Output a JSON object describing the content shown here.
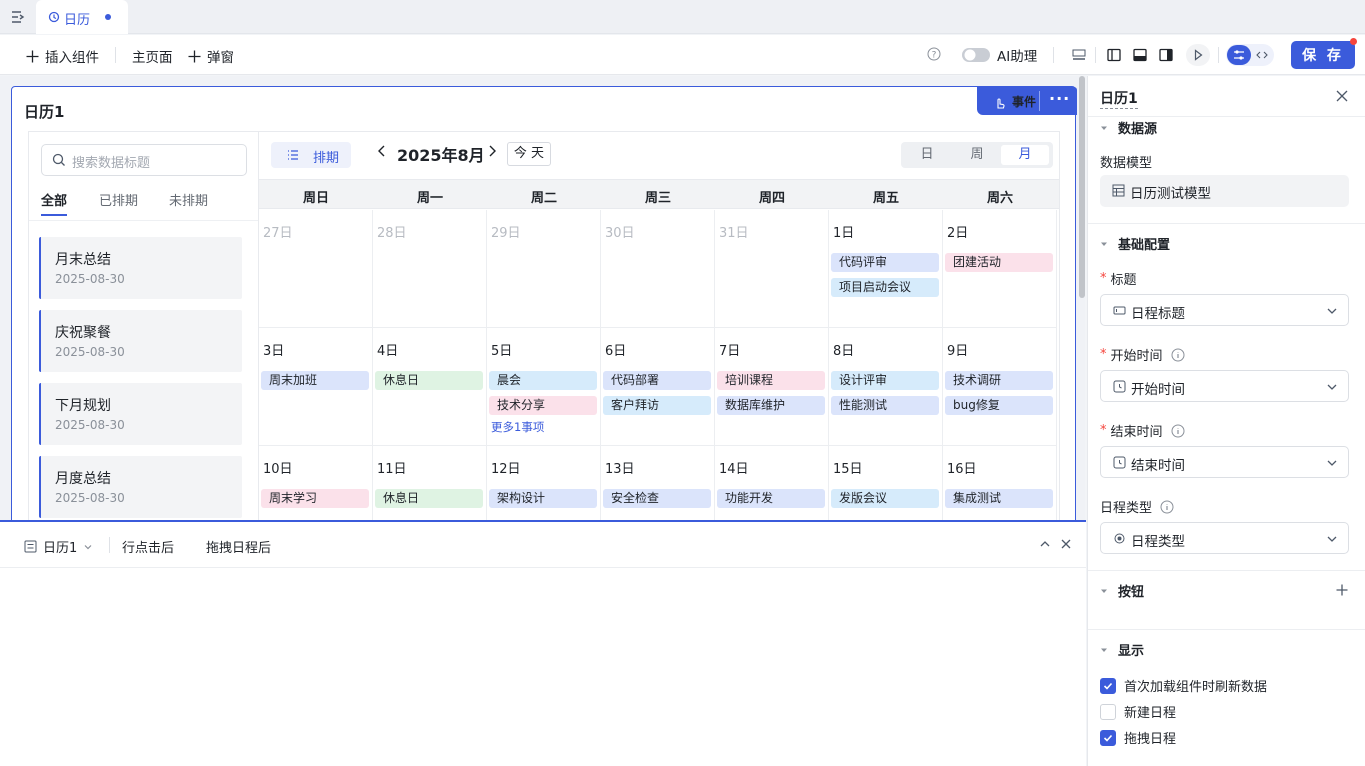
{
  "colors": {
    "accent": "#3b5bdb",
    "event_blue": "#dbe4fb",
    "event_pink": "#fbe1ea",
    "event_green": "#dff3e3",
    "event_sky": "#d6ebfb"
  },
  "tab": {
    "label": "日历",
    "icon": "calendar-icon"
  },
  "toolbar": {
    "insert_label": "插入组件",
    "home_label": "主页面",
    "popup_label": "弹窗",
    "ai_label": "AI助理",
    "ai_enabled": false,
    "save_label": "保 存"
  },
  "widget": {
    "title": "日历1",
    "event_label": "事件",
    "more_label": "···"
  },
  "list": {
    "search_placeholder": "搜索数据标题",
    "tabs": [
      "全部",
      "已排期",
      "未排期"
    ],
    "items": [
      {
        "title": "月末总结",
        "date": "2025-08-30"
      },
      {
        "title": "庆祝聚餐",
        "date": "2025-08-30"
      },
      {
        "title": "下月规划",
        "date": "2025-08-30"
      },
      {
        "title": "月度总结",
        "date": "2025-08-30"
      }
    ]
  },
  "calendar": {
    "schedule_label": "排期",
    "month": "2025年8月",
    "today_label": "今 天",
    "views": [
      "日",
      "周",
      "月"
    ],
    "active_view": "月",
    "weekdays": [
      "周日",
      "周一",
      "周二",
      "周三",
      "周四",
      "周五",
      "周六"
    ],
    "weeks": [
      [
        {
          "day": "27日",
          "out": true,
          "events": []
        },
        {
          "day": "28日",
          "out": true,
          "events": []
        },
        {
          "day": "29日",
          "out": true,
          "events": []
        },
        {
          "day": "30日",
          "out": true,
          "events": []
        },
        {
          "day": "31日",
          "out": true,
          "events": []
        },
        {
          "day": "1日",
          "events": [
            {
              "t": "代码评审",
              "c": "blue"
            },
            {
              "t": "项目启动会议",
              "c": "sky"
            }
          ]
        },
        {
          "day": "2日",
          "events": [
            {
              "t": "团建活动",
              "c": "pink"
            }
          ]
        }
      ],
      [
        {
          "day": "3日",
          "events": [
            {
              "t": "周末加班",
              "c": "blue"
            }
          ]
        },
        {
          "day": "4日",
          "events": [
            {
              "t": "休息日",
              "c": "green"
            }
          ]
        },
        {
          "day": "5日",
          "events": [
            {
              "t": "晨会",
              "c": "sky"
            },
            {
              "t": "技术分享",
              "c": "pink"
            }
          ],
          "more": "更多1事项"
        },
        {
          "day": "6日",
          "events": [
            {
              "t": "代码部署",
              "c": "blue"
            },
            {
              "t": "客户拜访",
              "c": "sky"
            }
          ]
        },
        {
          "day": "7日",
          "events": [
            {
              "t": "培训课程",
              "c": "pink"
            },
            {
              "t": "数据库维护",
              "c": "blue"
            }
          ]
        },
        {
          "day": "8日",
          "events": [
            {
              "t": "设计评审",
              "c": "sky"
            },
            {
              "t": "性能测试",
              "c": "blue"
            }
          ]
        },
        {
          "day": "9日",
          "events": [
            {
              "t": "技术调研",
              "c": "blue"
            },
            {
              "t": "bug修复",
              "c": "blue"
            }
          ]
        }
      ],
      [
        {
          "day": "10日",
          "events": [
            {
              "t": "周末学习",
              "c": "pink"
            }
          ]
        },
        {
          "day": "11日",
          "events": [
            {
              "t": "休息日",
              "c": "green"
            }
          ]
        },
        {
          "day": "12日",
          "events": [
            {
              "t": "架构设计",
              "c": "blue"
            }
          ]
        },
        {
          "day": "13日",
          "events": [
            {
              "t": "安全检查",
              "c": "blue"
            }
          ]
        },
        {
          "day": "14日",
          "events": [
            {
              "t": "功能开发",
              "c": "blue"
            }
          ]
        },
        {
          "day": "15日",
          "events": [
            {
              "t": "发版会议",
              "c": "sky"
            }
          ]
        },
        {
          "day": "16日",
          "events": [
            {
              "t": "集成测试",
              "c": "blue"
            }
          ]
        }
      ]
    ]
  },
  "bottom": {
    "component": "日历1",
    "tabs": [
      "行点击后",
      "拖拽日程后"
    ]
  },
  "props": {
    "title": "日历1",
    "datasource_section": "数据源",
    "model_label": "数据模型",
    "model_value": "日历测试模型",
    "basic_section": "基础配置",
    "title_label": "标题",
    "title_value": "日程标题",
    "start_label": "开始时间",
    "start_value": "开始时间",
    "end_label": "结束时间",
    "end_value": "结束时间",
    "type_label": "日程类型",
    "type_value": "日程类型",
    "button_section": "按钮",
    "display_section": "显示",
    "checks": [
      {
        "label": "首次加载组件时刷新数据",
        "checked": true
      },
      {
        "label": "新建日程",
        "checked": false
      },
      {
        "label": "拖拽日程",
        "checked": true
      }
    ]
  }
}
